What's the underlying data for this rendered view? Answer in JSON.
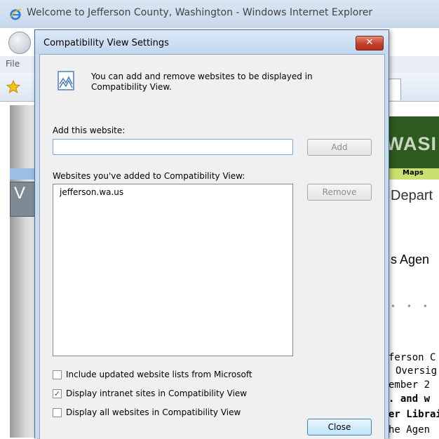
{
  "browser": {
    "window_title": "Welcome to Jefferson County, Washington - Windows Internet Explorer",
    "menu_first_item": "File",
    "page_fragments": {
      "banner_text": "WASI",
      "maps_link": "Maps",
      "left_tab_letter": "V",
      "department_heading": "Depart",
      "agenda_heading": "s Agen",
      "dots": "• • • •",
      "lines": [
        "ferson C",
        "Oversig",
        "ember 2",
        ". and w",
        "er Librai",
        "he Agen"
      ]
    }
  },
  "dialog": {
    "title": "Compatibility View Settings",
    "close_glyph": "✕",
    "info_text": "You can add and remove websites to be displayed in Compatibility View.",
    "add_label": "Add this website:",
    "add_input_value": "",
    "add_button": "Add",
    "list_label": "Websites you've added to Compatibility View:",
    "sites": [
      "jefferson.wa.us"
    ],
    "remove_button": "Remove",
    "checkboxes": [
      {
        "label": "Include updated website lists from Microsoft",
        "checked": false
      },
      {
        "label": "Display intranet sites in Compatibility View",
        "checked": true
      },
      {
        "label": "Display all websites in Compatibility View",
        "checked": false
      }
    ],
    "close_button": "Close"
  }
}
